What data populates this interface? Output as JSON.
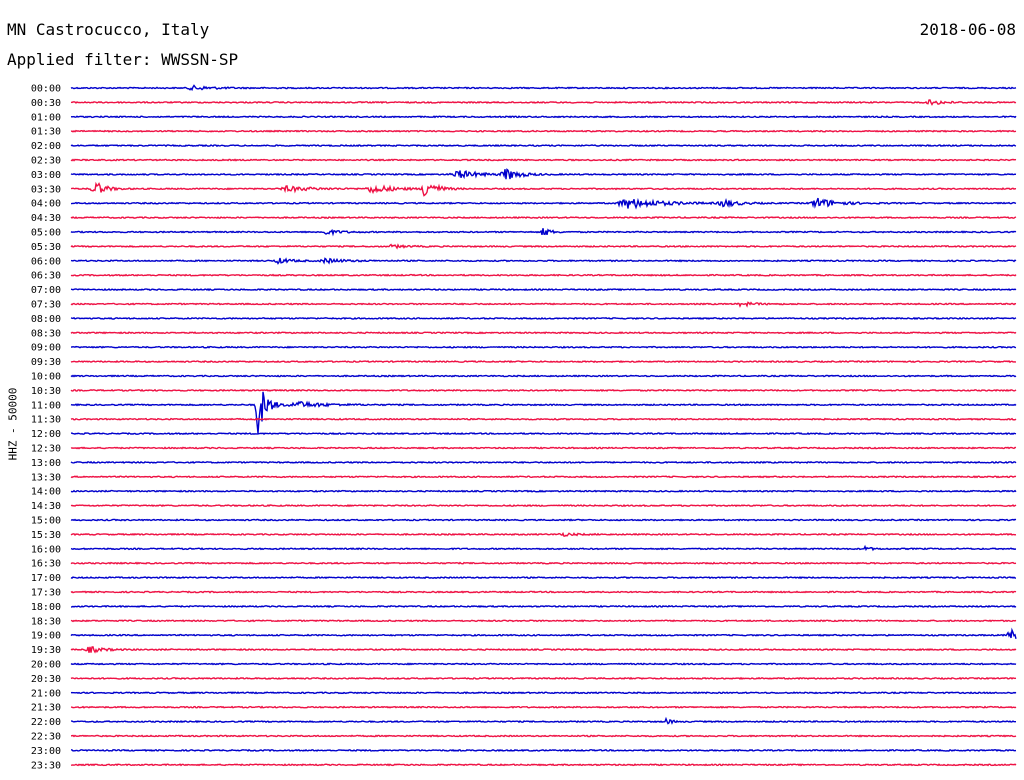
{
  "header": {
    "station": "MN Castrocucco, Italy",
    "date": "2018-06-08",
    "filter": "Applied filter: WWSSN-SP"
  },
  "chart_data": {
    "type": "line",
    "title": "MN Castrocucco, Italy",
    "ylabel": "HHZ - 50000",
    "row_labels": [
      "00:00",
      "00:30",
      "01:00",
      "01:30",
      "02:00",
      "02:30",
      "03:00",
      "03:30",
      "04:00",
      "04:30",
      "05:00",
      "05:30",
      "06:00",
      "06:30",
      "07:00",
      "07:30",
      "08:00",
      "08:30",
      "09:00",
      "09:30",
      "10:00",
      "10:30",
      "11:00",
      "11:30",
      "12:00",
      "12:30",
      "13:00",
      "13:30",
      "14:00",
      "14:30",
      "15:00",
      "15:30",
      "16:00",
      "16:30",
      "17:00",
      "17:30",
      "18:00",
      "18:30",
      "19:00",
      "19:30",
      "20:00",
      "20:30",
      "21:00",
      "21:30",
      "22:00",
      "22:30",
      "23:00",
      "23:30"
    ],
    "trace_colors": [
      "#0000cc",
      "#ee1144"
    ],
    "grid": false,
    "events": [
      {
        "row": "00:00",
        "x": 0.13,
        "amp": 2,
        "width": 0.03
      },
      {
        "row": "00:30",
        "x": 0.91,
        "amp": 2.5,
        "width": 0.02
      },
      {
        "row": "03:00",
        "x": 0.41,
        "amp": 4,
        "width": 0.03
      },
      {
        "row": "03:00",
        "x": 0.46,
        "amp": 6,
        "width": 0.02
      },
      {
        "row": "03:30",
        "x": 0.025,
        "amp": 8,
        "width": 0.015
      },
      {
        "row": "03:30",
        "x": 0.23,
        "amp": 2.5,
        "width": 0.04
      },
      {
        "row": "03:30",
        "x": 0.32,
        "amp": 4,
        "width": 0.03
      },
      {
        "row": "03:30",
        "x": 0.375,
        "amp": 11,
        "width": 0.015
      },
      {
        "row": "04:00",
        "x": 0.59,
        "amp": 5,
        "width": 0.05
      },
      {
        "row": "04:00",
        "x": 0.69,
        "amp": 4,
        "width": 0.02
      },
      {
        "row": "04:00",
        "x": 0.79,
        "amp": 5,
        "width": 0.03
      },
      {
        "row": "05:00",
        "x": 0.27,
        "amp": 2.5,
        "width": 0.02
      },
      {
        "row": "05:00",
        "x": 0.5,
        "amp": 5,
        "width": 0.01
      },
      {
        "row": "05:30",
        "x": 0.34,
        "amp": 1.5,
        "width": 0.02
      },
      {
        "row": "06:00",
        "x": 0.22,
        "amp": 2.5,
        "width": 0.02
      },
      {
        "row": "06:00",
        "x": 0.27,
        "amp": 2,
        "width": 0.03
      },
      {
        "row": "07:30",
        "x": 0.71,
        "amp": 2,
        "width": 0.02
      },
      {
        "row": "11:00",
        "x": 0.198,
        "amp": 30,
        "width": 0.012
      },
      {
        "row": "11:00",
        "x": 0.24,
        "amp": 3,
        "width": 0.04
      },
      {
        "row": "15:30",
        "x": 0.52,
        "amp": 1.5,
        "width": 0.02
      },
      {
        "row": "16:00",
        "x": 0.84,
        "amp": 2,
        "width": 0.01
      },
      {
        "row": "19:00",
        "x": 0.995,
        "amp": 6,
        "width": 0.02
      },
      {
        "row": "19:30",
        "x": 0.02,
        "amp": 3,
        "width": 0.02
      },
      {
        "row": "22:00",
        "x": 0.63,
        "amp": 3,
        "width": 0.008
      }
    ]
  }
}
